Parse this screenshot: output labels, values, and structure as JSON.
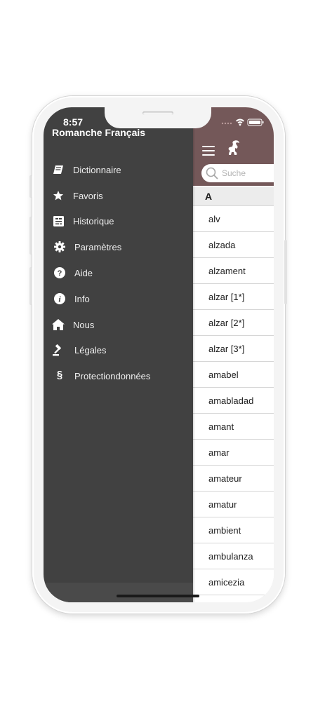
{
  "status_bar": {
    "time": "8:57"
  },
  "drawer": {
    "title": "Romanche Français",
    "items": [
      {
        "label": "Dictionnaire",
        "icon": "book-icon"
      },
      {
        "label": "Favoris",
        "icon": "star-icon"
      },
      {
        "label": "Historique",
        "icon": "history-icon"
      },
      {
        "label": "Paramètres",
        "icon": "gear-icon"
      },
      {
        "label": "Aide",
        "icon": "question-icon"
      },
      {
        "label": "Info",
        "icon": "info-icon"
      },
      {
        "label": "Nous",
        "icon": "house-icon"
      },
      {
        "label": "Légales",
        "icon": "gavel-icon"
      },
      {
        "label": "Protectiondonnées",
        "icon": "section-sign-icon",
        "glyph": "§"
      }
    ]
  },
  "search": {
    "placeholder": "Suche"
  },
  "section_header": "A",
  "words": [
    "alv",
    "alzada",
    "alzament",
    "alzar [1*]",
    "alzar [2*]",
    "alzar [3*]",
    "amabel",
    "amabladad",
    "amant",
    "amar",
    "amateur",
    "amatur",
    "ambient",
    "ambulanza",
    "amicezia"
  ],
  "colors": {
    "drawer_background": "#414141",
    "header_background": "#745859",
    "section_background": "#ececec"
  }
}
